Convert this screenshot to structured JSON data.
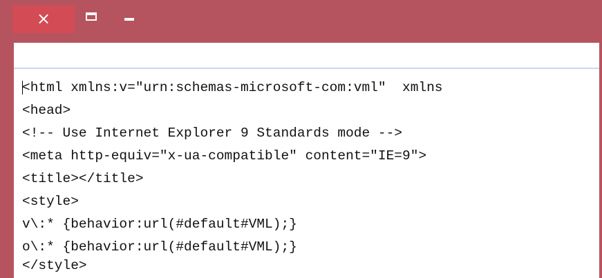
{
  "window": {
    "close_label": "×"
  },
  "editor": {
    "lines": [
      "<html xmlns:v=\"urn:schemas-microsoft-com:vml\"  xmlns",
      "<head>",
      "<!-- Use Internet Explorer 9 Standards mode -->",
      "<meta http-equiv=\"x-ua-compatible\" content=\"IE=9\">",
      "<title></title>",
      "<style>",
      "v\\:* {behavior:url(#default#VML);}",
      "o\\:* {behavior:url(#default#VML);}",
      "</style>"
    ]
  },
  "colors": {
    "titlebar": "#b5545e",
    "close_button": "#d24b55",
    "toolbar_border": "#c8d8ef"
  }
}
